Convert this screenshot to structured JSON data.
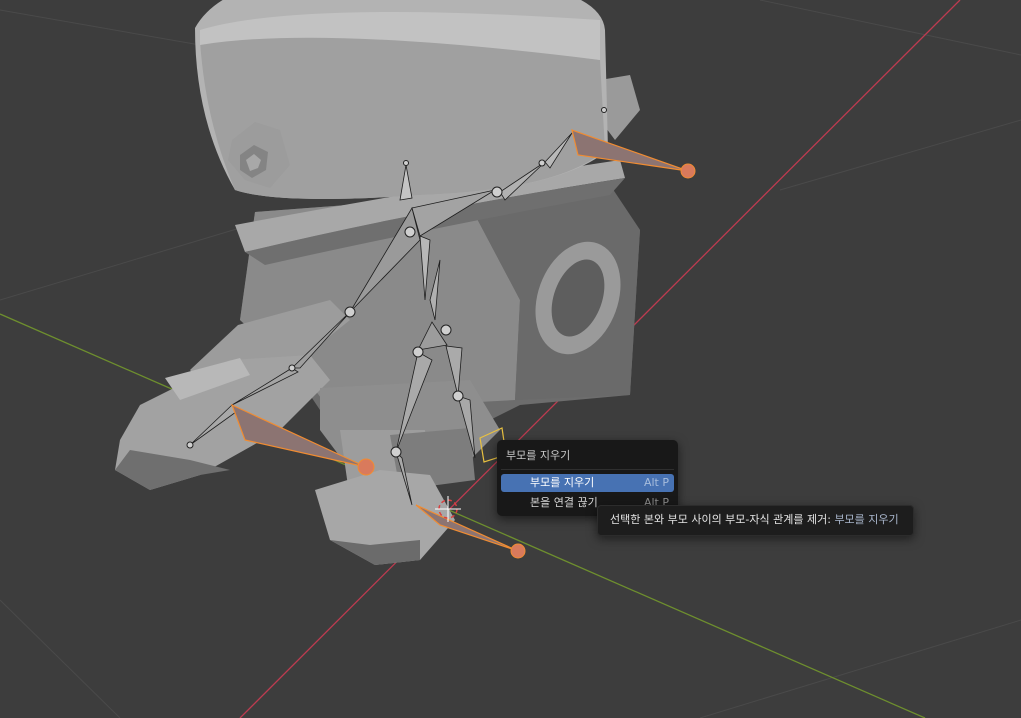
{
  "context_menu": {
    "title": "부모를 지우기",
    "items": [
      {
        "label": "부모를 지우기",
        "shortcut": "Alt P",
        "active": true
      },
      {
        "label": "본을 연결 끊기",
        "shortcut": "Alt P",
        "active": false
      }
    ]
  },
  "tooltip": {
    "description": "선택한 본와 부모 사이의 부모-자식 관계를 제거:",
    "operator_name": "부모를 지우기"
  },
  "colors": {
    "viewport_bg": "#3d3d3d",
    "grid_line": "#474747",
    "x_axis": "#bd3b50",
    "y_axis": "#6e8f2e",
    "selected_bone_outline": "#f08c32",
    "menu_highlight": "#4772b3"
  }
}
